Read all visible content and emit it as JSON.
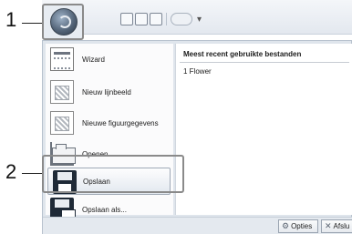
{
  "callouts": {
    "one": "1",
    "two": "2"
  },
  "menu": {
    "items": [
      {
        "label": "Wizard",
        "icon": "wizard-icon"
      },
      {
        "label": "Nieuw lijnbeeld",
        "icon": "new-line-image-icon"
      },
      {
        "label": "Nieuwe figuurgegevens",
        "icon": "new-figure-data-icon"
      },
      {
        "label": "Openen...",
        "icon": "folder-open-icon"
      },
      {
        "label": "Opslaan",
        "icon": "floppy-save-icon"
      },
      {
        "label": "Opslaan als...",
        "icon": "floppy-save-as-icon"
      }
    ],
    "highlighted": "Opslaan"
  },
  "recent": {
    "title": "Meest recent gebruikte bestanden",
    "items": [
      {
        "label": "1 Flower"
      }
    ]
  },
  "bottom": {
    "options_label": "Opties",
    "exit_label": "Afslu"
  },
  "colors": {
    "menu_bg": "#dfe5ec",
    "highlight_border": "#9fa9b6",
    "callout_frame": "#8a8a8a"
  }
}
